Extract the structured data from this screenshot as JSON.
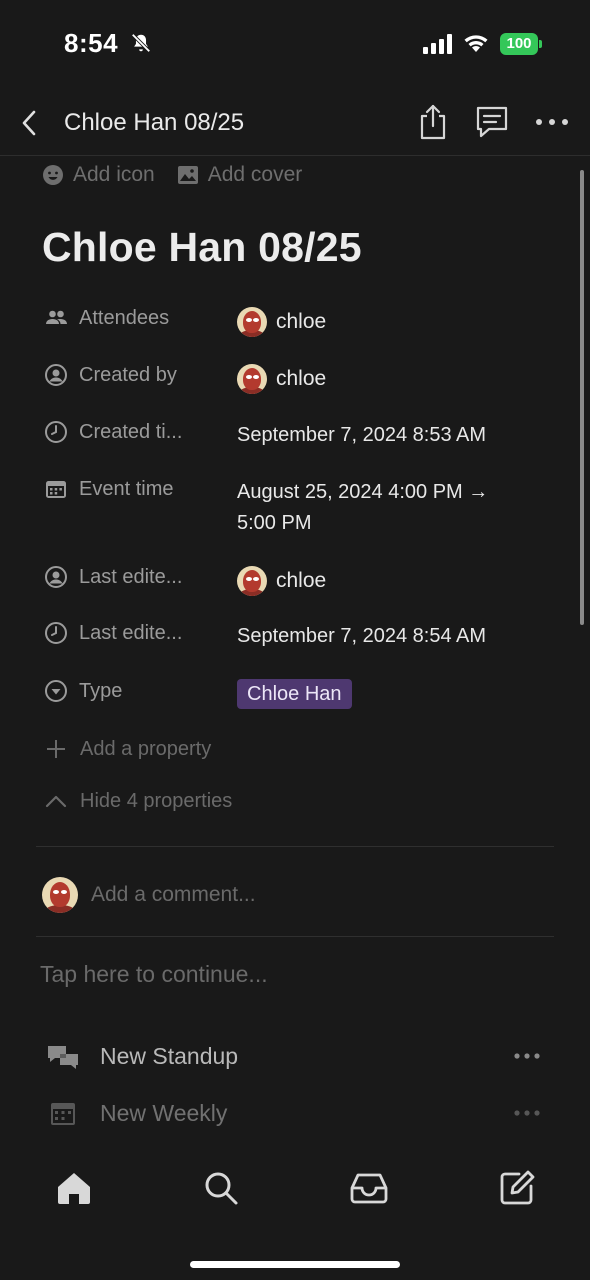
{
  "status_bar": {
    "time": "8:54",
    "battery": "100"
  },
  "nav": {
    "title": "Chloe Han 08/25"
  },
  "page_actions": {
    "add_icon": "Add icon",
    "add_cover": "Add cover"
  },
  "page": {
    "title": "Chloe Han 08/25"
  },
  "properties": [
    {
      "icon": "people-icon",
      "label": "Attendees",
      "value": "chloe"
    },
    {
      "icon": "person-circle-icon",
      "label": "Created by",
      "value": "chloe"
    },
    {
      "icon": "clock-icon",
      "label": "Created ti...",
      "value": "September 7, 2024 8:53 AM"
    },
    {
      "icon": "calendar-icon",
      "label": "Event time",
      "value": "August 25, 2024 4:00 PM →",
      "value_line2": "5:00 PM"
    },
    {
      "icon": "person-circle-icon",
      "label": "Last edite...",
      "value": "chloe"
    },
    {
      "icon": "clock-icon",
      "label": "Last edite...",
      "value": "September 7, 2024 8:54 AM"
    },
    {
      "icon": "select-icon",
      "label": "Type",
      "value": "Chloe Han"
    }
  ],
  "add_property": "Add a property",
  "hide_properties": "Hide 4 properties",
  "comment": {
    "placeholder": "Add a comment..."
  },
  "continue_placeholder": "Tap here to continue...",
  "templates": [
    {
      "icon": "chat-bubbles-icon",
      "label": "New Standup"
    },
    {
      "icon": "calendar-icon",
      "label": "New Weekly"
    }
  ],
  "tabs": [
    "home-icon",
    "search-icon",
    "inbox-icon",
    "compose-icon"
  ],
  "colors": {
    "background": "#191919",
    "tag": "#4e3870",
    "battery": "#34c759"
  }
}
